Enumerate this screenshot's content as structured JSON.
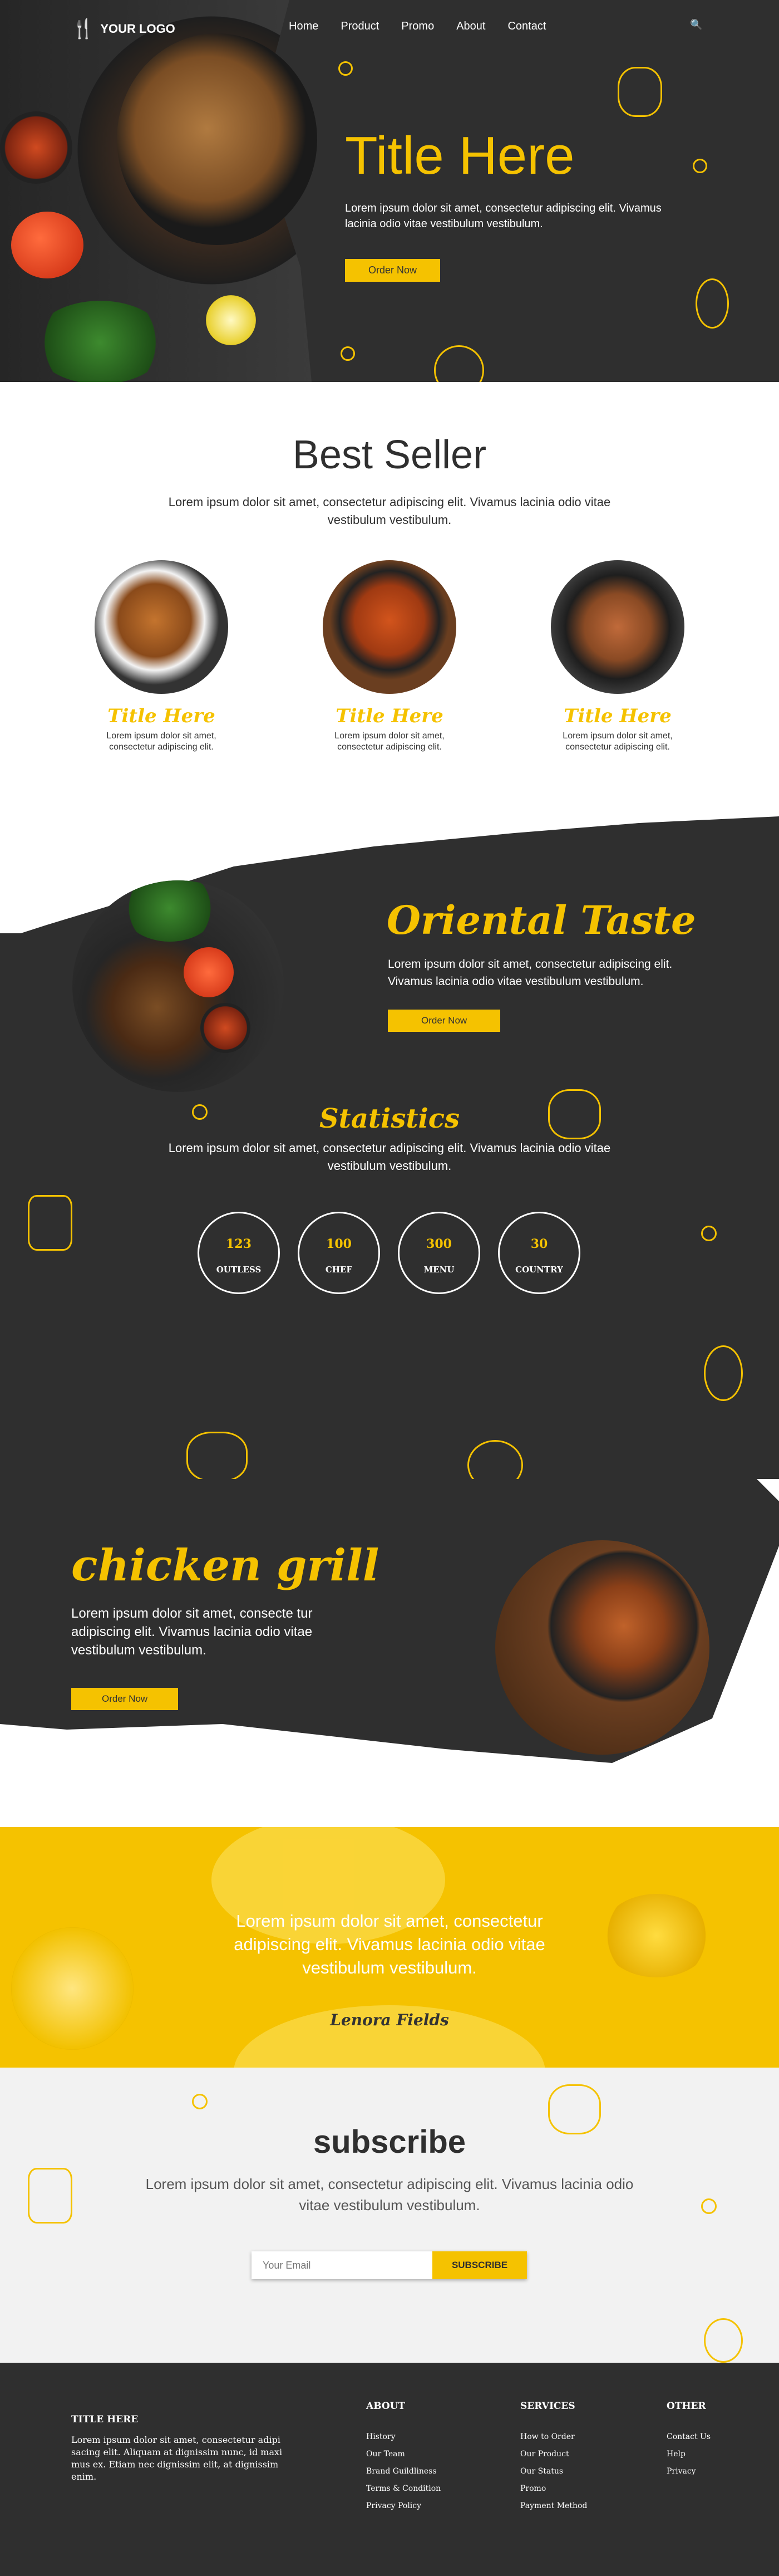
{
  "nav": {
    "logo": "YOUR LOGO",
    "items": [
      "Home",
      "Product",
      "Promo",
      "About",
      "Contact"
    ]
  },
  "hero": {
    "title": "Title Here",
    "text": "Lorem ipsum dolor sit amet, consectetur adipiscing elit. Vivamus lacinia odio vitae vestibulum vestibulum.",
    "button": "Order Now"
  },
  "best_seller": {
    "title": "Best Seller",
    "intro": "Lorem ipsum dolor sit amet, consectetur adipiscing elit. Vivamus lacinia odio vitae vestibulum vestibulum.",
    "items": [
      {
        "title": "Title Here",
        "text": "Lorem ipsum dolor sit amet, consectetur adipiscing elit."
      },
      {
        "title": "Title Here",
        "text": "Lorem ipsum dolor sit amet, consectetur adipiscing elit."
      },
      {
        "title": "Title Here",
        "text": "Lorem ipsum dolor sit amet, consectetur adipiscing elit."
      }
    ]
  },
  "oriental": {
    "title": "Oriental Taste",
    "text": "Lorem ipsum dolor sit amet, consectetur adipiscing elit. Vivamus lacinia odio vitae vestibulum vestibulum.",
    "button": "Order Now"
  },
  "statistics": {
    "title": "Statistics",
    "text": "Lorem ipsum dolor sit amet, consectetur adipiscing elit. Vivamus lacinia odio vitae vestibulum vestibulum.",
    "items": [
      {
        "value": "123",
        "label": "OUTLESS"
      },
      {
        "value": "100",
        "label": "CHEF"
      },
      {
        "value": "300",
        "label": "MENU"
      },
      {
        "value": "30",
        "label": "COUNTRY"
      }
    ]
  },
  "grill": {
    "title": "chicken grill",
    "text": "Lorem ipsum dolor sit amet, consecte tur adipiscing elit. Vivamus lacinia odio vitae vestibulum vestibulum.",
    "button": "Order Now"
  },
  "quote": {
    "text": "Lorem ipsum dolor sit amet, consectetur adipiscing elit. Vivamus lacinia odio vitae vestibulum vestibulum.",
    "author": "Lenora Fields"
  },
  "subscribe": {
    "title": "subscribe",
    "text": "Lorem ipsum dolor sit amet, consectetur adipiscing elit. Vivamus lacinia odio vitae vestibulum vestibulum.",
    "placeholder": "Your Email",
    "button": "SUBSCRIBE"
  },
  "footer": {
    "title": "TITLE HERE",
    "text": "Lorem ipsum dolor sit amet, consectetur adipi sacing elit. Aliquam at dignissim nunc, id maxi mus ex. Etiam nec dignissim elit, at dignissim enim.",
    "columns": [
      {
        "heading": "ABOUT",
        "links": [
          "History",
          "Our Team",
          "Brand Guildliness",
          "Terms & Condition",
          "Privacy Policy"
        ]
      },
      {
        "heading": "SERVICES",
        "links": [
          "How to Order",
          "Our Product",
          "Our Status",
          "Promo",
          "Payment Method"
        ]
      },
      {
        "heading": "OTHER",
        "links": [
          "Contact Us",
          "Help",
          "Privacy"
        ]
      }
    ]
  },
  "colors": {
    "accent": "#f5c200",
    "dark": "#2f2f2f"
  }
}
